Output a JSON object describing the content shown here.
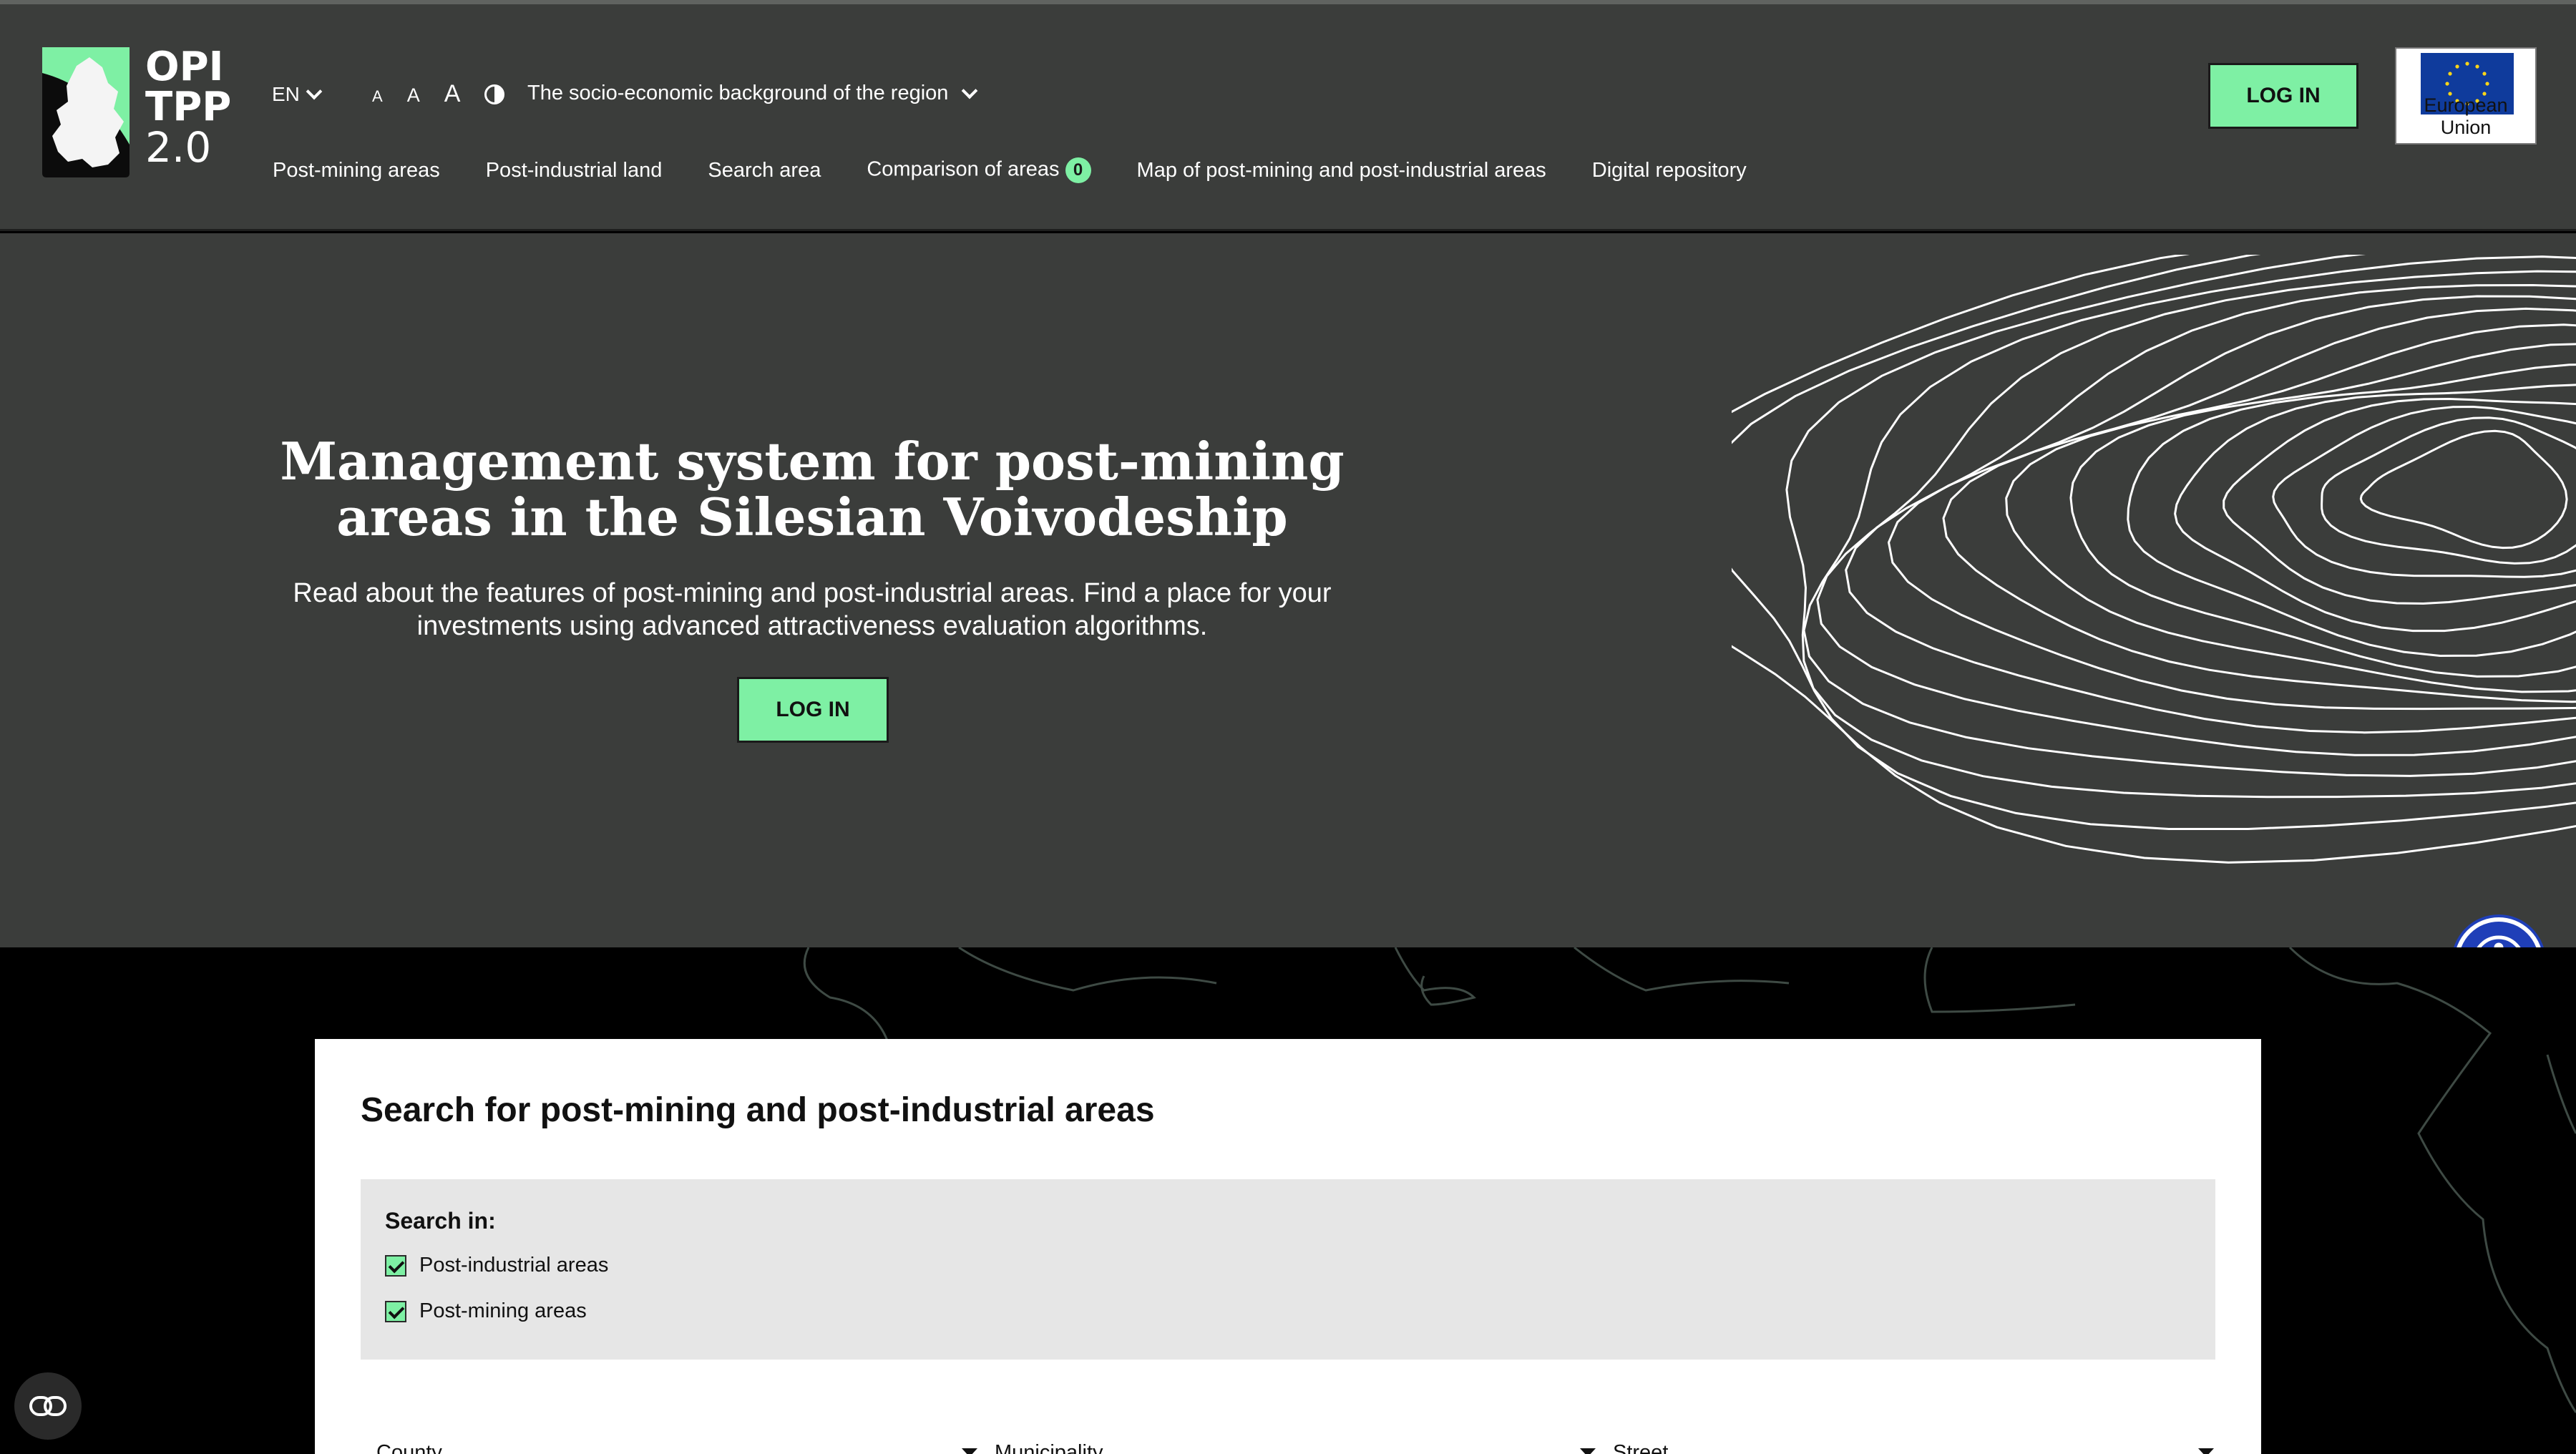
{
  "logo": {
    "line1": "OPI",
    "line2": "TPP",
    "line3": "2.0"
  },
  "header": {
    "language": "EN",
    "font_sizes": [
      "A",
      "A",
      "A"
    ],
    "region_dropdown": "The socio-economic background of the region",
    "nav": [
      {
        "label": "Post-mining areas"
      },
      {
        "label": "Post-industrial land"
      },
      {
        "label": "Search area"
      },
      {
        "label": "Comparison of areas",
        "badge": "0"
      },
      {
        "label": "Map of post-mining and post-industrial areas"
      },
      {
        "label": "Digital repository"
      }
    ],
    "login_label": "LOG IN",
    "eu_label": "European Union"
  },
  "hero": {
    "title": "Management system for post-mining areas in the Silesian Voivodeship",
    "subtitle": "Read about the features of post-mining and post-industrial areas. Find a place for your investments using advanced attractiveness evaluation algorithms.",
    "login_label": "LOG IN"
  },
  "search": {
    "title": "Search for post-mining and post-industrial areas",
    "search_in_label": "Search in:",
    "options": [
      {
        "label": "Post-industrial areas",
        "checked": true
      },
      {
        "label": "Post-mining areas",
        "checked": true
      }
    ],
    "fields": [
      {
        "label": "County"
      },
      {
        "label": "Municipality"
      },
      {
        "label": "Street"
      }
    ]
  },
  "colors": {
    "header_bg": "#3b3d3b",
    "accent": "#7ef0a4",
    "access_blue": "#1f3fb8",
    "eu_blue": "#0f3b9c"
  }
}
